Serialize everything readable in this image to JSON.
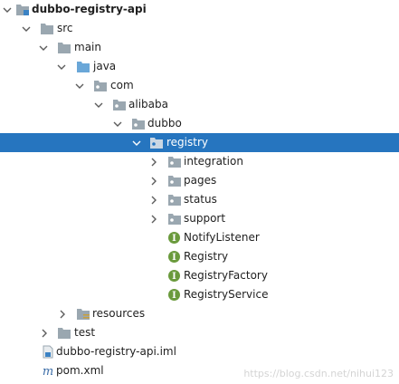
{
  "project_tree": {
    "nodes": [
      {
        "label": "dubbo-registry-api",
        "icon": "module-folder-icon",
        "chevron": "expanded",
        "bold": true
      },
      {
        "label": "src",
        "icon": "folder-icon",
        "chevron": "expanded"
      },
      {
        "label": "main",
        "icon": "folder-icon",
        "chevron": "expanded"
      },
      {
        "label": "java",
        "icon": "source-root-folder-icon",
        "chevron": "expanded"
      },
      {
        "label": "com",
        "icon": "package-icon",
        "chevron": "expanded"
      },
      {
        "label": "alibaba",
        "icon": "package-icon",
        "chevron": "expanded"
      },
      {
        "label": "dubbo",
        "icon": "package-icon",
        "chevron": "expanded"
      },
      {
        "label": "registry",
        "icon": "package-icon",
        "chevron": "expanded",
        "selected": true
      },
      {
        "label": "integration",
        "icon": "package-icon",
        "chevron": "collapsed"
      },
      {
        "label": "pages",
        "icon": "package-icon",
        "chevron": "collapsed"
      },
      {
        "label": "status",
        "icon": "package-icon",
        "chevron": "collapsed"
      },
      {
        "label": "support",
        "icon": "package-icon",
        "chevron": "collapsed"
      },
      {
        "label": "NotifyListener",
        "icon": "interface-icon",
        "chevron": "none"
      },
      {
        "label": "Registry",
        "icon": "interface-icon",
        "chevron": "none"
      },
      {
        "label": "RegistryFactory",
        "icon": "interface-icon",
        "chevron": "none"
      },
      {
        "label": "RegistryService",
        "icon": "interface-icon",
        "chevron": "none"
      },
      {
        "label": "resources",
        "icon": "resources-folder-icon",
        "chevron": "collapsed"
      },
      {
        "label": "test",
        "icon": "folder-icon",
        "chevron": "collapsed"
      },
      {
        "label": "dubbo-registry-api.iml",
        "icon": "iml-file-icon",
        "chevron": "none"
      },
      {
        "label": "pom.xml",
        "icon": "maven-icon",
        "chevron": "none"
      }
    ]
  },
  "watermark": "https://blog.csdn.net/nihui123",
  "colors": {
    "selection": "#2675bf",
    "folder": "#9aa7b0",
    "source_folder": "#6aa7d8",
    "interface_badge": "#6a9a3c",
    "chevron": "#5c5c5c"
  }
}
